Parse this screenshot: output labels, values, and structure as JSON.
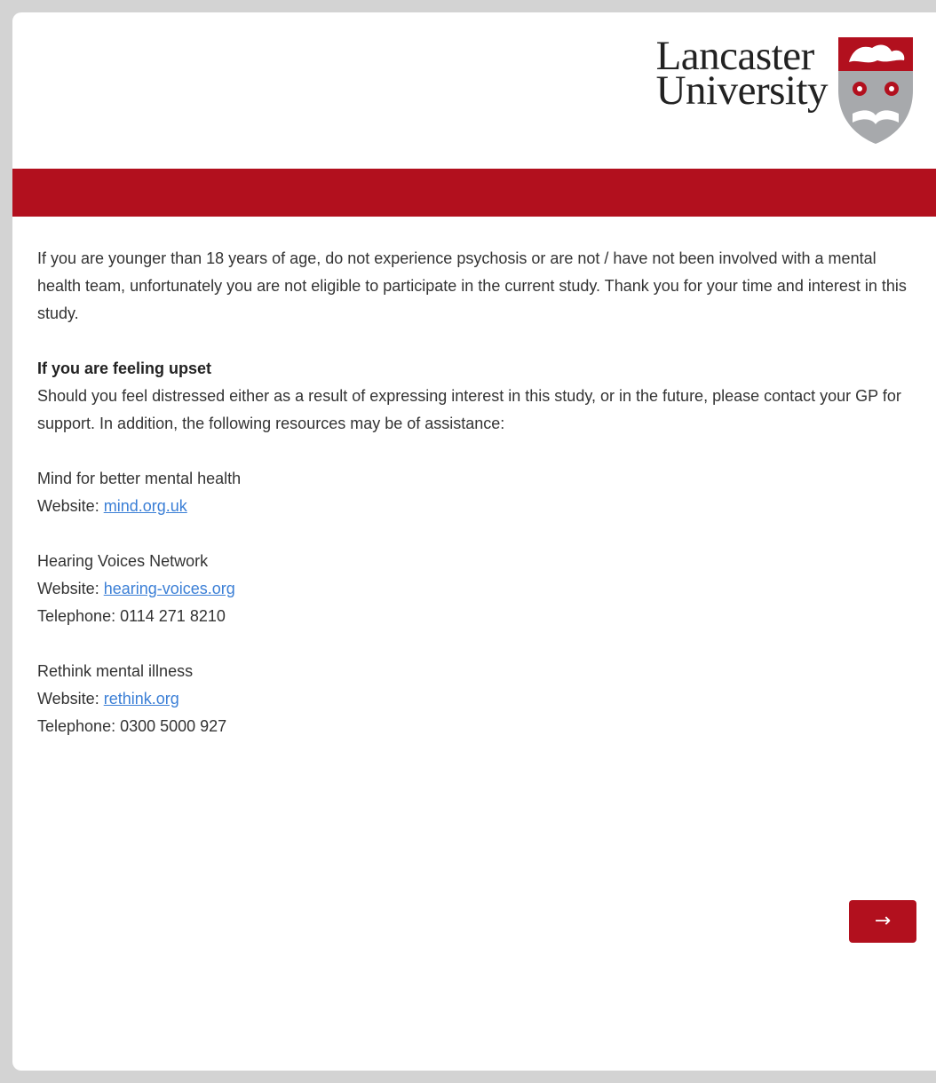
{
  "brand": {
    "name_line1": "Lancaster",
    "name_line2": "University",
    "primary_color": "#b2101e",
    "crest_icon": "university-crest-icon"
  },
  "intro": "If you are younger than 18 years of age, do not experience psychosis or are not / have not been involved with a mental health team, unfortunately you are not eligible to participate in the current study. Thank you for your time and interest in this study.",
  "support": {
    "heading": "If you are feeling upset",
    "body": "Should you feel distressed either as a result of expressing interest in this study, or in the future, please contact your GP for support. In addition, the following resources may be of assistance:"
  },
  "resources": [
    {
      "name": "Mind for better mental health",
      "website_label": "Website:",
      "website": "mind.org.uk"
    },
    {
      "name": "Hearing Voices Network",
      "website_label": "Website:",
      "website": "hearing-voices.org",
      "telephone": "Telephone: 0114 271 8210"
    },
    {
      "name": "Rethink mental illness",
      "website_label": "Website:",
      "website": "rethink.org",
      "telephone": "Telephone: 0300 5000 927"
    }
  ],
  "navigation": {
    "next_label": "→",
    "next_icon": "arrow-right-icon"
  }
}
